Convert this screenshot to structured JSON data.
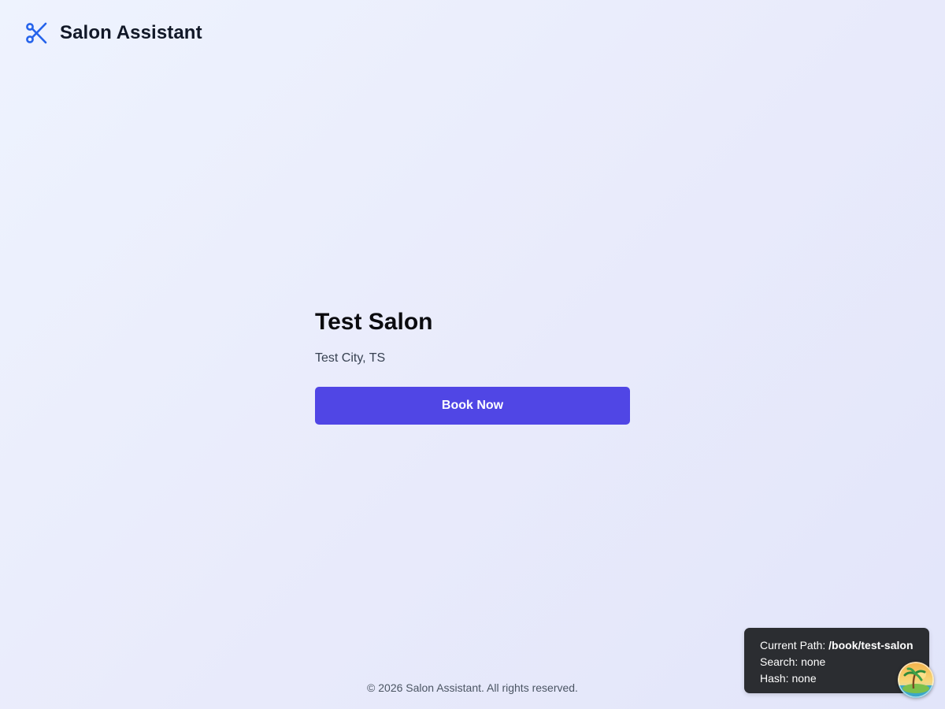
{
  "header": {
    "brand": "Salon Assistant",
    "logo_icon": "scissors-icon",
    "accent_color": "#2563eb"
  },
  "salon": {
    "name": "Test Salon",
    "location": "Test City, TS",
    "book_label": "Book Now",
    "button_color": "#5046e5"
  },
  "footer": {
    "copyright": "© 2026 Salon Assistant. All rights reserved."
  },
  "debug": {
    "path_label": "Current Path:",
    "path_value": "/book/test-salon",
    "search_label": "Search:",
    "search_value": "none",
    "hash_label": "Hash:",
    "hash_value": "none"
  },
  "devtools": {
    "icon": "palm-tree-island-icon"
  }
}
